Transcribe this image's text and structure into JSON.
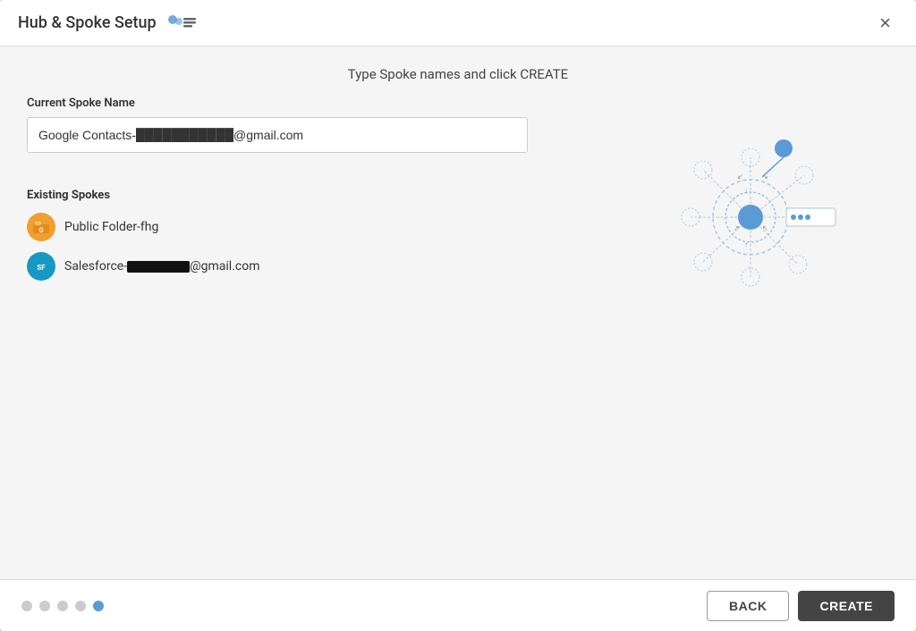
{
  "modal": {
    "title": "Hub & Spoke Setup",
    "close_label": "×"
  },
  "instructions": {
    "text": "Type Spoke names and click CREATE"
  },
  "form": {
    "current_spoke_label": "Current Spoke Name",
    "current_spoke_value": "Google Contacts-",
    "current_spoke_suffix": "@gmail.com"
  },
  "existing_spokes": {
    "label": "Existing Spokes",
    "items": [
      {
        "name": "Public Folder-fhg",
        "type": "public-folder"
      },
      {
        "name": "Salesforce-",
        "suffix": "@gmail.com",
        "type": "salesforce"
      }
    ]
  },
  "pagination": {
    "dots": [
      false,
      false,
      false,
      false,
      true
    ]
  },
  "footer": {
    "back_label": "BACK",
    "create_label": "CREATE"
  },
  "colors": {
    "accent": "#5b9bd5",
    "dark_btn": "#444444"
  }
}
